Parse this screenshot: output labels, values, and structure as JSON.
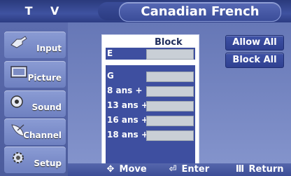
{
  "header": {
    "left_label": "T V",
    "title": "Canadian French"
  },
  "sidebar": {
    "items": [
      {
        "label": "Input",
        "icon": "input-plug-icon"
      },
      {
        "label": "Picture",
        "icon": "picture-screen-icon"
      },
      {
        "label": "Sound",
        "icon": "speaker-icon"
      },
      {
        "label": "Channel",
        "icon": "satellite-dish-icon"
      },
      {
        "label": "Setup",
        "icon": "setup-gear-icon"
      }
    ]
  },
  "block_panel": {
    "header": "Block",
    "ratings": [
      {
        "label": "E"
      },
      {
        "label": "G"
      },
      {
        "label": "8 ans +"
      },
      {
        "label": "13 ans +"
      },
      {
        "label": "16 ans +"
      },
      {
        "label": "18 ans +"
      }
    ]
  },
  "buttons": {
    "allow_all": "Allow All",
    "block_all": "Block All"
  },
  "footer": {
    "move": {
      "label": "Move",
      "icon": "diamond-arrows-icon"
    },
    "enter": {
      "label": "Enter",
      "icon": "enter-icon"
    },
    "return": {
      "label": "Return",
      "icon": "return-icon"
    }
  },
  "colors": {
    "accent": "#3e4fa0",
    "header": "#2a3a7c"
  }
}
